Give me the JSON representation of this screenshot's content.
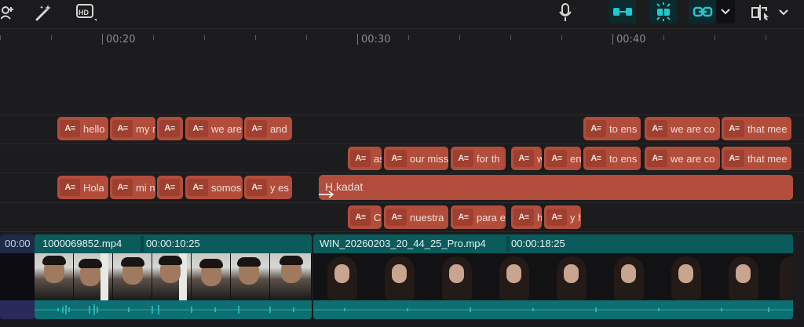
{
  "toolbar": {
    "icons": [
      "add-person-icon",
      "magic-wand-icon",
      "hd-icon",
      "microphone-icon",
      "link-track-icon",
      "snap-icon",
      "link-clips-icon",
      "split-preview-icon"
    ],
    "hd_label": "HD",
    "accent": "#1ec8d2"
  },
  "ruler": {
    "labels": [
      "00:20",
      "00:30",
      "00:40"
    ]
  },
  "tracks": {
    "captions_row1": [
      "hello",
      "my n",
      "",
      "we are",
      "and",
      "to ens",
      "we are co",
      "that mee"
    ],
    "captions_row2": [
      "as",
      "our miss",
      "for th",
      "w",
      "en",
      "to ens",
      "we are co",
      "that mee"
    ],
    "captions_row3": [
      "Hola",
      "mi n",
      "",
      "somos",
      "y es"
    ],
    "long_clip": "H.kadat",
    "captions_row4": [
      "C",
      "nuestra",
      "para e",
      "h",
      "y h"
    ],
    "caption_badge": "A≡"
  },
  "video": {
    "left_time": "00:00",
    "clip1_name": "1000069852.mp4",
    "clip1_duration": "00:00:10:25",
    "clip2_name": "WIN_20260203_20_44_25_Pro.mp4",
    "clip2_duration": "00:00:18:25"
  },
  "colors": {
    "caption_clip": "#b24d3c",
    "video_clip": "#0f5d5f"
  }
}
